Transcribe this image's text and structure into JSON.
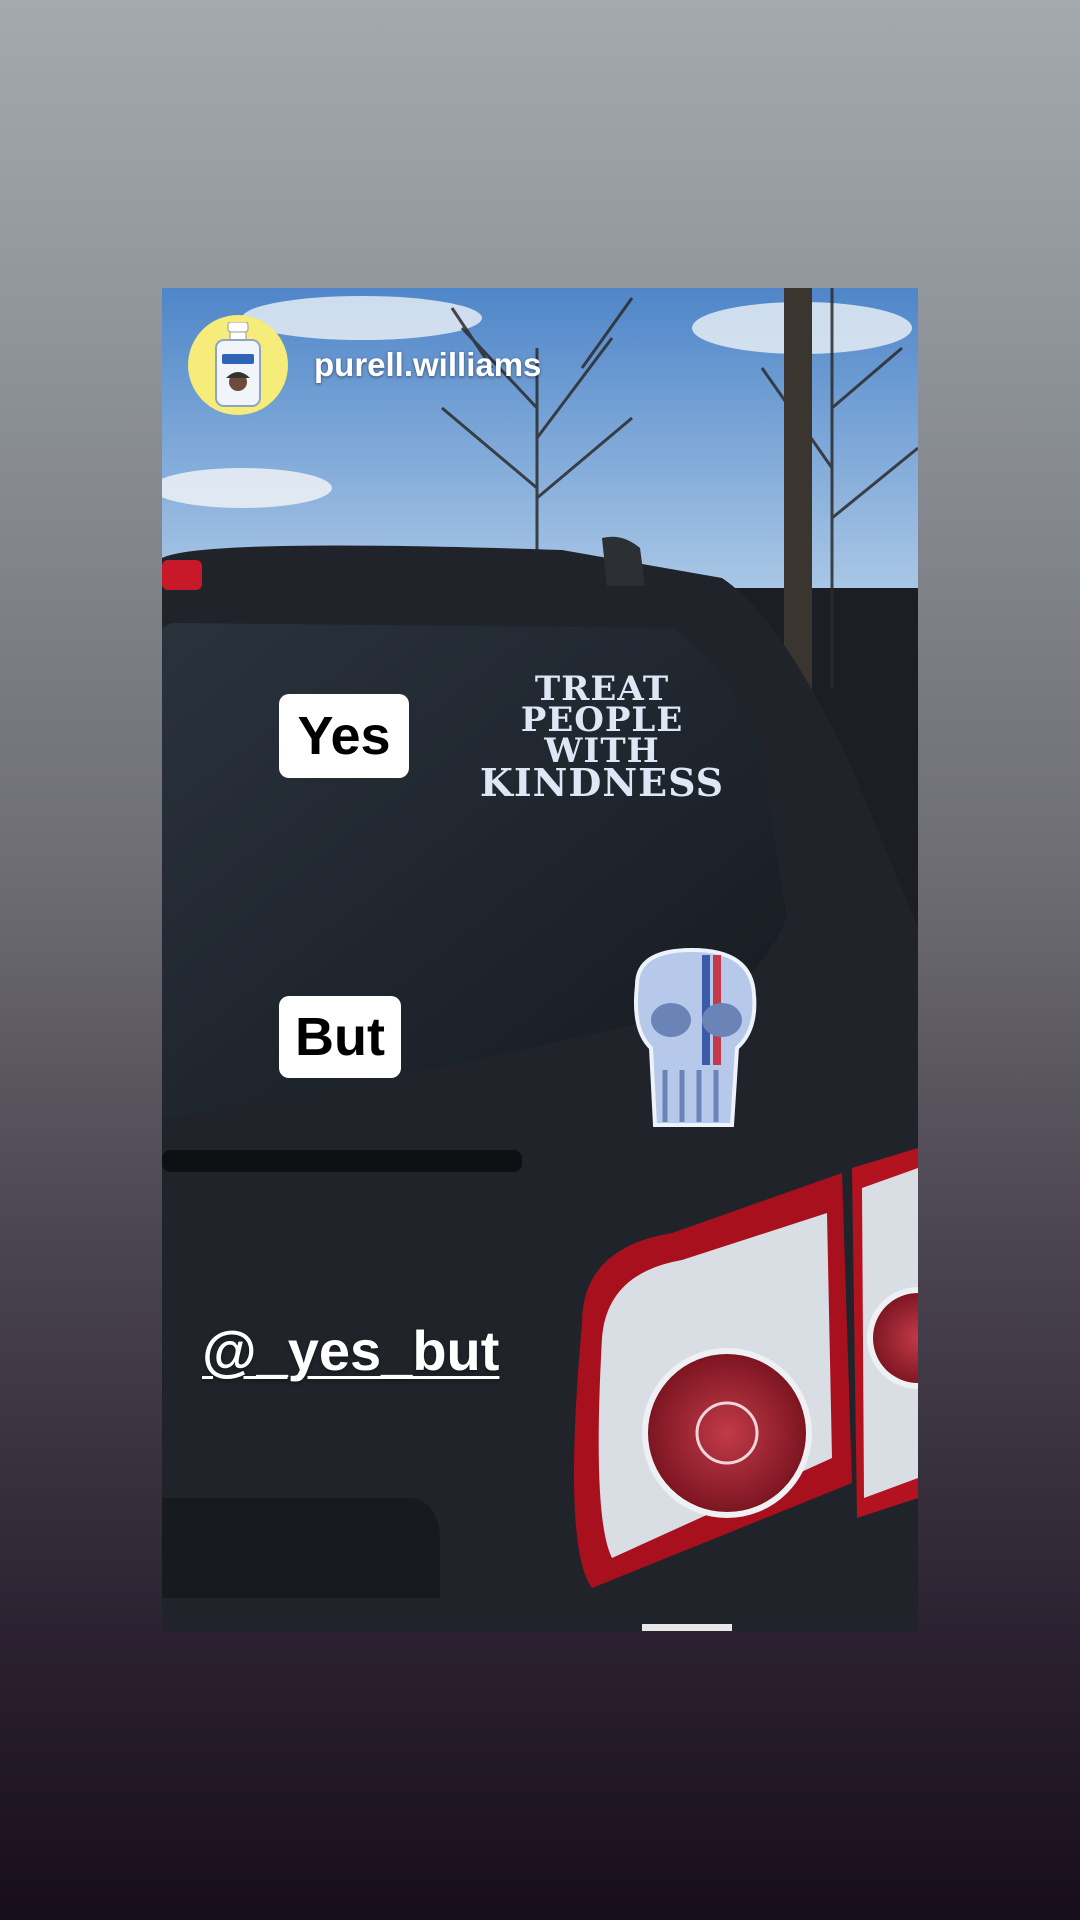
{
  "story": {
    "author": {
      "username": "purell.williams",
      "avatar_icon": "hand-sanitizer-bottle-icon"
    },
    "labels": {
      "yes": "Yes",
      "but": "But"
    },
    "sticker_text": [
      "TREAT",
      "PEOPLE",
      "WITH",
      "KINDNESS"
    ],
    "mention": "@_yes_but",
    "colors": {
      "avatar_bg": "#f6ec7a",
      "label_bg": "#ffffff",
      "sticker": "#dfe6f6"
    }
  }
}
